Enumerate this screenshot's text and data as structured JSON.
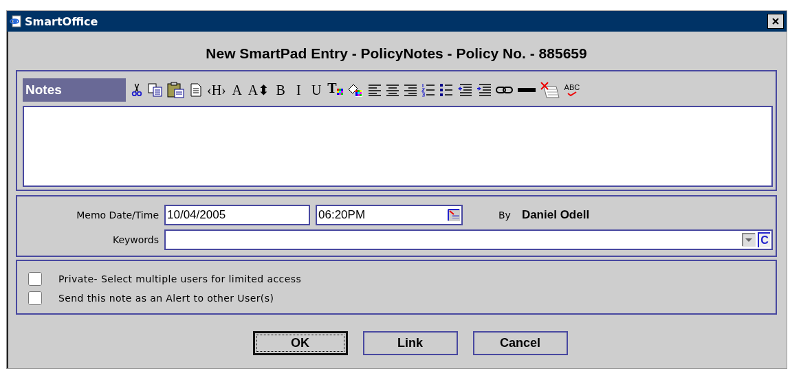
{
  "window": {
    "title": "SmartOffice"
  },
  "heading": "New SmartPad Entry - PolicyNotes - Policy No. - 885659",
  "notes": {
    "label": "Notes",
    "toolbar": [
      {
        "kind": "cut"
      },
      {
        "kind": "copy"
      },
      {
        "kind": "paste"
      },
      {
        "kind": "document"
      },
      {
        "kind": "serif-glyph",
        "label": "‹H›"
      },
      {
        "kind": "serif-glyph",
        "label": "A"
      },
      {
        "kind": "serif-glyph",
        "label": "A⬍"
      },
      {
        "kind": "bold-glyph",
        "label": "B"
      },
      {
        "kind": "italic-glyph",
        "label": "I"
      },
      {
        "kind": "underline-glyph",
        "label": "U"
      },
      {
        "kind": "color-glyph",
        "label": "T"
      },
      {
        "kind": "fill"
      },
      {
        "kind": "align-left"
      },
      {
        "kind": "align-center"
      },
      {
        "kind": "align-right"
      },
      {
        "kind": "numbered-list"
      },
      {
        "kind": "bullet-list"
      },
      {
        "kind": "outdent"
      },
      {
        "kind": "indent"
      },
      {
        "kind": "link"
      },
      {
        "kind": "rule"
      },
      {
        "kind": "clear"
      },
      {
        "kind": "spell",
        "label": "ABC"
      }
    ]
  },
  "memo": {
    "label": "Memo Date/Time",
    "date": "10/04/2005",
    "time": "06:20PM",
    "by_label": "By",
    "by_value": "Daniel Odell"
  },
  "keywords": {
    "label": "Keywords",
    "c_button": "C"
  },
  "options": [
    {
      "label": "Private- Select multiple users for limited access",
      "checked": false
    },
    {
      "label": "Send this note as an Alert to other User(s)",
      "checked": false
    }
  ],
  "buttons": [
    {
      "label": "OK",
      "default": true
    },
    {
      "label": "Link",
      "default": false
    },
    {
      "label": "Cancel",
      "default": false
    }
  ]
}
